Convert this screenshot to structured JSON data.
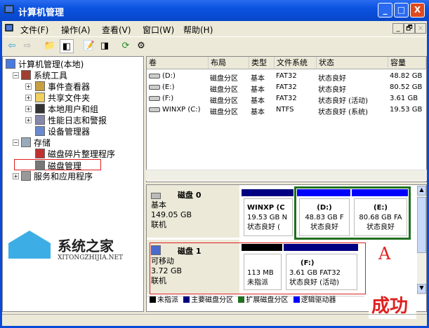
{
  "window": {
    "title": "计算机管理",
    "min": "_",
    "max": "□",
    "close": "X"
  },
  "menu": [
    "文件(F)",
    "操作(A)",
    "查看(V)",
    "窗口(W)",
    "帮助(H)"
  ],
  "mdi_buttons": [
    "_",
    "🗗",
    "×"
  ],
  "tree": {
    "root": "计算机管理(本地)",
    "system_tools": "系统工具",
    "event_viewer": "事件查看器",
    "shared_folders": "共享文件夹",
    "local_users": "本地用户和组",
    "perf_logs": "性能日志和警报",
    "device_manager": "设备管理器",
    "storage": "存储",
    "defrag": "磁盘碎片整理程序",
    "disk_mgmt": "磁盘管理",
    "services": "服务和应用程序"
  },
  "list": {
    "columns": [
      "卷",
      "布局",
      "类型",
      "文件系统",
      "状态",
      "容量"
    ],
    "rows": [
      {
        "vol": "(D:)",
        "layout": "磁盘分区",
        "type": "基本",
        "fs": "FAT32",
        "status": "状态良好",
        "cap": "48.82 GB"
      },
      {
        "vol": "(E:)",
        "layout": "磁盘分区",
        "type": "基本",
        "fs": "FAT32",
        "status": "状态良好",
        "cap": "80.52 GB"
      },
      {
        "vol": "(F:)",
        "layout": "磁盘分区",
        "type": "基本",
        "fs": "FAT32",
        "status": "状态良好 (活动)",
        "cap": "3.61 GB"
      },
      {
        "vol": "WINXP (C:)",
        "layout": "磁盘分区",
        "type": "基本",
        "fs": "NTFS",
        "status": "状态良好 (系统)",
        "cap": "19.53 GB"
      }
    ]
  },
  "disks": [
    {
      "name": "磁盘 0",
      "type": "基本",
      "size": "149.05 GB",
      "state": "联机",
      "parts": [
        {
          "title": "WINXP (C",
          "line2": "19.53 GB N",
          "line3": "状态良好 ("
        },
        {
          "title": "(D:)",
          "line2": "48.83 GB F",
          "line3": "状态良好"
        },
        {
          "title": "(E:)",
          "line2": "80.68 GB FA",
          "line3": "状态良好"
        }
      ]
    },
    {
      "name": "磁盘 1",
      "type": "可移动",
      "size": "3.72 GB",
      "state": "联机",
      "parts": [
        {
          "title": "",
          "line2": "113 MB",
          "line3": "未指派"
        },
        {
          "title": "(F:)",
          "line2": "3.61 GB FAT32",
          "line3": "状态良好 (活动)"
        }
      ]
    }
  ],
  "legend": [
    "未指派",
    "主要磁盘分区",
    "扩展磁盘分区",
    "逻辑驱动器"
  ],
  "annotations": {
    "a": "A",
    "success": "成功"
  },
  "watermark": {
    "name": "系统之家",
    "url": "XITONGZHIJIA.NET"
  },
  "colors": {
    "primary": "#000080",
    "logical": "#0000ff",
    "extended": "#207020",
    "unallocated": "#000000",
    "highlight": "#e02020"
  }
}
